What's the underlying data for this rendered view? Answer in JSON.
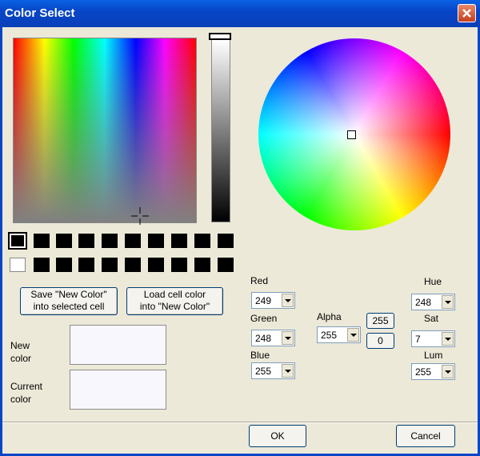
{
  "window": {
    "title": "Color Select"
  },
  "buttons": {
    "save_new_color": "Save \"New Color\"\ninto selected cell",
    "load_cell_color": "Load cell color\ninto \"New Color\"",
    "ok": "OK",
    "cancel": "Cancel",
    "alpha_max": "255",
    "alpha_min": "0"
  },
  "labels": {
    "new_color": "New\ncolor",
    "current_color": "Current\ncolor",
    "red": "Red",
    "green": "Green",
    "blue": "Blue",
    "alpha": "Alpha",
    "hue": "Hue",
    "sat": "Sat",
    "lum": "Lum"
  },
  "fields": {
    "red": "249",
    "green": "248",
    "blue": "255",
    "alpha": "255",
    "hue": "248",
    "sat": "7",
    "lum": "255"
  },
  "colors": {
    "new_color": "#f8f7fd",
    "current_color": "#f8f7fd",
    "custom_cells": "#000000",
    "selected_cell_border": "#ffffff"
  },
  "icons": {
    "close": "close-icon",
    "crosshair": "crosshair-icon",
    "dropdown": "chevron-down-icon"
  }
}
